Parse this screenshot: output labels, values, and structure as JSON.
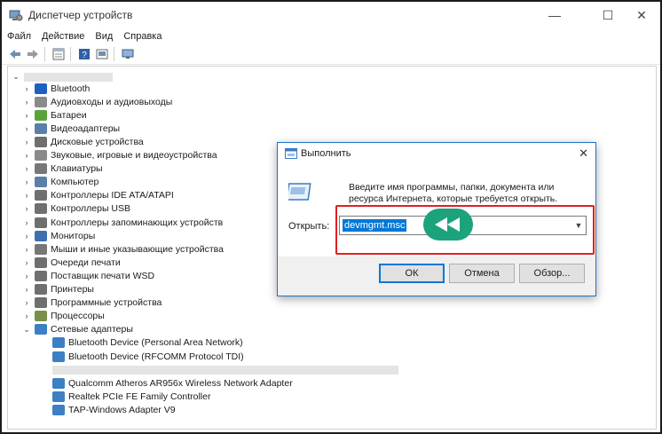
{
  "window": {
    "title": "Диспетчер устройств",
    "minimize": "—",
    "maximize": "☐",
    "close": "✕"
  },
  "menu": [
    "Файл",
    "Действие",
    "Вид",
    "Справка"
  ],
  "tree": {
    "categories": [
      {
        "label": "Bluetooth",
        "icon": "bluetooth-icon"
      },
      {
        "label": "Аудиовходы и аудиовыходы",
        "icon": "audio-icon"
      },
      {
        "label": "Батареи",
        "icon": "battery-icon"
      },
      {
        "label": "Видеоадаптеры",
        "icon": "display-adapter-icon"
      },
      {
        "label": "Дисковые устройства",
        "icon": "disk-icon"
      },
      {
        "label": "Звуковые, игровые и видеоустройства",
        "icon": "sound-icon"
      },
      {
        "label": "Клавиатуры",
        "icon": "keyboard-icon"
      },
      {
        "label": "Компьютер",
        "icon": "computer-icon"
      },
      {
        "label": "Контроллеры IDE ATA/ATAPI",
        "icon": "ide-controller-icon"
      },
      {
        "label": "Контроллеры USB",
        "icon": "usb-icon"
      },
      {
        "label": "Контроллеры запоминающих устройств",
        "icon": "storage-controller-icon"
      },
      {
        "label": "Мониторы",
        "icon": "monitor-icon"
      },
      {
        "label": "Мыши и иные указывающие устройства",
        "icon": "mouse-icon"
      },
      {
        "label": "Очереди печати",
        "icon": "print-queue-icon"
      },
      {
        "label": "Поставщик печати WSD",
        "icon": "wsd-printer-icon"
      },
      {
        "label": "Принтеры",
        "icon": "printer-icon"
      },
      {
        "label": "Программные устройства",
        "icon": "software-device-icon"
      },
      {
        "label": "Процессоры",
        "icon": "processor-icon"
      },
      {
        "label": "Сетевые адаптеры",
        "icon": "network-adapter-icon",
        "expanded": true
      }
    ],
    "network_adapters": [
      "Bluetooth Device (Personal Area Network)",
      "Bluetooth Device (RFCOMM Protocol TDI)",
      "",
      "Qualcomm Atheros AR956x Wireless Network Adapter",
      "Realtek PCIe FE Family Controller",
      "TAP-Windows Adapter V9"
    ]
  },
  "run_dialog": {
    "title": "Выполнить",
    "description": "Введите имя программы, папки, документа или ресурса Интернета, которые требуется открыть.",
    "open_label": "Открыть:",
    "input_value": "devmgmt.msc",
    "ok_label": "ОК",
    "cancel_label": "Отмена",
    "browse_label": "Обзор...",
    "close_glyph": "✕"
  },
  "colors": {
    "accent": "#0078d7",
    "highlight_box": "#e02020",
    "pointer_badge": "#1da37b"
  }
}
